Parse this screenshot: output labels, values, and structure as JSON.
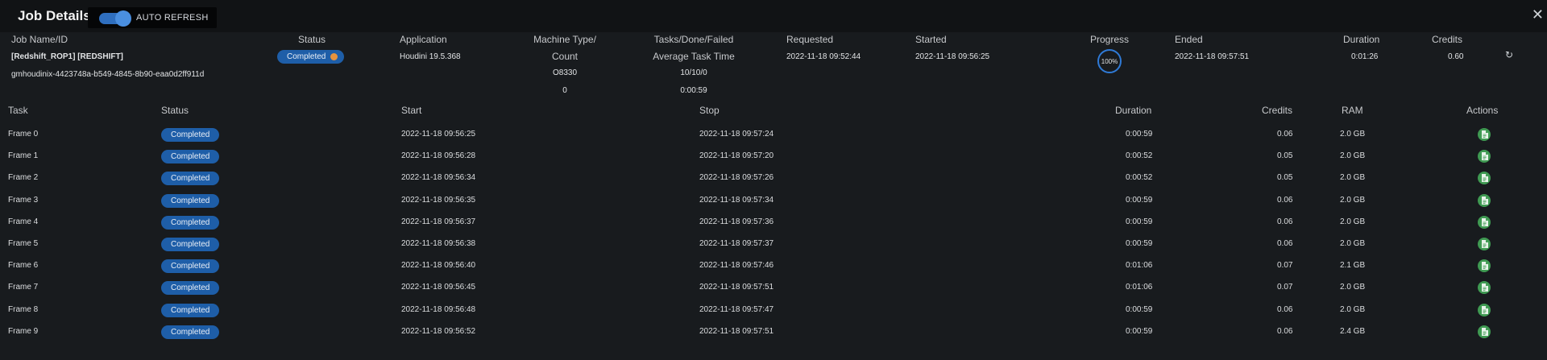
{
  "header": {
    "title": "Job Details",
    "auto_refresh_label": "AUTO REFRESH",
    "auto_refresh_on": true,
    "close_glyph": "✕"
  },
  "job": {
    "columns": {
      "name": "Job Name/ID",
      "status": "Status",
      "application": "Application",
      "machine_line1": "Machine Type/",
      "machine_line2": "Count",
      "tasks_line1": "Tasks/Done/Failed",
      "tasks_line2": "Average Task Time",
      "requested": "Requested",
      "started": "Started",
      "progress": "Progress",
      "ended": "Ended",
      "duration": "Duration",
      "credits": "Credits"
    },
    "name": "[Redshift_ROP1] [REDSHIFT]",
    "id": "gmhoudinix-4423748a-b549-4845-8b90-eaa0d2ff911d",
    "status": "Completed",
    "application": "Houdini 19.5.368",
    "machine_type": "O8330",
    "machine_count": "0",
    "tasks": "10/10/0",
    "avg_task_time": "0:00:59",
    "requested": "2022-11-18 09:52:44",
    "started": "2022-11-18 09:56:25",
    "progress": "100%",
    "progress_value": 100,
    "ended": "2022-11-18 09:57:51",
    "duration": "0:01:26",
    "credits": "0.60",
    "refresh_icon": "refresh-icon"
  },
  "tasks": {
    "columns": {
      "task": "Task",
      "status": "Status",
      "start": "Start",
      "stop": "Stop",
      "duration": "Duration",
      "credits": "Credits",
      "ram": "RAM",
      "actions": "Actions"
    },
    "rows": [
      {
        "task": "Frame 0",
        "status": "Completed",
        "start": "2022-11-18 09:56:25",
        "stop": "2022-11-18 09:57:24",
        "duration": "0:00:59",
        "credits": "0.06",
        "ram": "2.0 GB"
      },
      {
        "task": "Frame 1",
        "status": "Completed",
        "start": "2022-11-18 09:56:28",
        "stop": "2022-11-18 09:57:20",
        "duration": "0:00:52",
        "credits": "0.05",
        "ram": "2.0 GB"
      },
      {
        "task": "Frame 2",
        "status": "Completed",
        "start": "2022-11-18 09:56:34",
        "stop": "2022-11-18 09:57:26",
        "duration": "0:00:52",
        "credits": "0.05",
        "ram": "2.0 GB"
      },
      {
        "task": "Frame 3",
        "status": "Completed",
        "start": "2022-11-18 09:56:35",
        "stop": "2022-11-18 09:57:34",
        "duration": "0:00:59",
        "credits": "0.06",
        "ram": "2.0 GB"
      },
      {
        "task": "Frame 4",
        "status": "Completed",
        "start": "2022-11-18 09:56:37",
        "stop": "2022-11-18 09:57:36",
        "duration": "0:00:59",
        "credits": "0.06",
        "ram": "2.0 GB"
      },
      {
        "task": "Frame 5",
        "status": "Completed",
        "start": "2022-11-18 09:56:38",
        "stop": "2022-11-18 09:57:37",
        "duration": "0:00:59",
        "credits": "0.06",
        "ram": "2.0 GB"
      },
      {
        "task": "Frame 6",
        "status": "Completed",
        "start": "2022-11-18 09:56:40",
        "stop": "2022-11-18 09:57:46",
        "duration": "0:01:06",
        "credits": "0.07",
        "ram": "2.1 GB"
      },
      {
        "task": "Frame 7",
        "status": "Completed",
        "start": "2022-11-18 09:56:45",
        "stop": "2022-11-18 09:57:51",
        "duration": "0:01:06",
        "credits": "0.07",
        "ram": "2.0 GB"
      },
      {
        "task": "Frame 8",
        "status": "Completed",
        "start": "2022-11-18 09:56:48",
        "stop": "2022-11-18 09:57:47",
        "duration": "0:00:59",
        "credits": "0.06",
        "ram": "2.0 GB"
      },
      {
        "task": "Frame 9",
        "status": "Completed",
        "start": "2022-11-18 09:56:52",
        "stop": "2022-11-18 09:57:51",
        "duration": "0:00:59",
        "credits": "0.06",
        "ram": "2.4 GB"
      }
    ],
    "action_icon": "document-icon"
  },
  "colors": {
    "background": "#181b1e",
    "titlebar": "#111315",
    "badge": "#1e5ea8",
    "accent": "#2f7ad6",
    "action": "#3f9a52",
    "status_dot": "#e6933e"
  }
}
